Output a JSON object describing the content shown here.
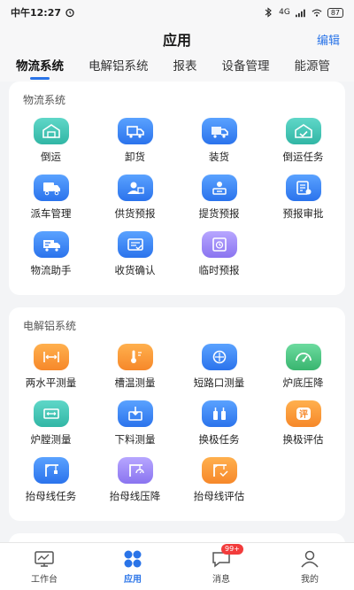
{
  "status_bar": {
    "carrier": "中午12:27",
    "icons": [
      "alarm-icon",
      "bluetooth-icon",
      "signal-icon",
      "wifi-icon"
    ],
    "network": "4G",
    "battery": "87"
  },
  "header": {
    "title": "应用",
    "edit_label": "编辑"
  },
  "tabs": [
    {
      "label": "物流系统",
      "active": true
    },
    {
      "label": "电解铝系统",
      "active": false
    },
    {
      "label": "报表",
      "active": false
    },
    {
      "label": "设备管理",
      "active": false
    },
    {
      "label": "能源管",
      "active": false
    }
  ],
  "sections": [
    {
      "title": "物流系统",
      "items": [
        {
          "label": "倒运",
          "icon": "warehouse-icon",
          "color": "teal"
        },
        {
          "label": "卸货",
          "icon": "unload-truck-icon",
          "color": "blue"
        },
        {
          "label": "装货",
          "icon": "load-truck-icon",
          "color": "blue"
        },
        {
          "label": "倒运任务",
          "icon": "warehouse-task-icon",
          "color": "teal"
        },
        {
          "label": "派车管理",
          "icon": "truck-icon",
          "color": "blue"
        },
        {
          "label": "供货预报",
          "icon": "supplier-icon",
          "color": "blue"
        },
        {
          "label": "提货预报",
          "icon": "pickup-icon",
          "color": "blue"
        },
        {
          "label": "预报审批",
          "icon": "approval-icon",
          "color": "blue"
        },
        {
          "label": "物流助手",
          "icon": "delivery-truck-icon",
          "color": "blue"
        },
        {
          "label": "收货确认",
          "icon": "receipt-icon",
          "color": "blue"
        },
        {
          "label": "临时预报",
          "icon": "clock-doc-icon",
          "color": "purple"
        }
      ]
    },
    {
      "title": "电解铝系统",
      "items": [
        {
          "label": "两水平测量",
          "icon": "level-ruler-icon",
          "color": "orange"
        },
        {
          "label": "槽温测量",
          "icon": "thermometer-icon",
          "color": "orange"
        },
        {
          "label": "短路口测量",
          "icon": "gauge-circle-icon",
          "color": "blue"
        },
        {
          "label": "炉底压降",
          "icon": "pressure-gauge-icon",
          "color": "green"
        },
        {
          "label": "炉膛测量",
          "icon": "furnace-ruler-icon",
          "color": "teal"
        },
        {
          "label": "下料测量",
          "icon": "feed-box-icon",
          "color": "blue"
        },
        {
          "label": "换极任务",
          "icon": "electrode-swap-icon",
          "color": "blue"
        },
        {
          "label": "换极评估",
          "icon": "evaluate-icon",
          "color": "orange"
        },
        {
          "label": "抬母线任务",
          "icon": "crane-icon",
          "color": "blue"
        },
        {
          "label": "抬母线压降",
          "icon": "crane-pressure-icon",
          "color": "purple"
        },
        {
          "label": "抬母线评估",
          "icon": "crane-evaluate-icon",
          "color": "orange"
        }
      ]
    }
  ],
  "evaluate_glyph": "评",
  "bottom_nav": [
    {
      "label": "工作台",
      "icon": "monitor-icon",
      "active": false
    },
    {
      "label": "应用",
      "icon": "apps-icon",
      "active": true
    },
    {
      "label": "消息",
      "icon": "message-icon",
      "active": false,
      "badge": "99+"
    },
    {
      "label": "我的",
      "icon": "user-icon",
      "active": false
    }
  ]
}
